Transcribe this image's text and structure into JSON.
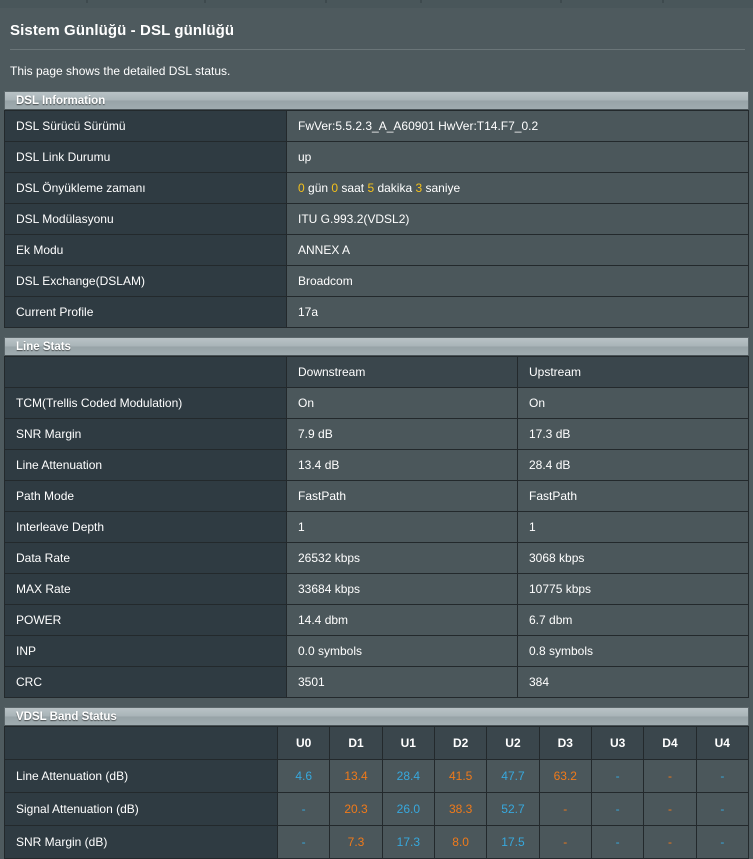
{
  "page": {
    "title": "Sistem Günlüğü - DSL günlüğü",
    "description": "This page shows the detailed DSL status."
  },
  "colors": {
    "upstream_accent": "#37a8dd",
    "downstream_accent": "#f07a1a",
    "highlight_number": "#f3c01b",
    "page_background": "#4e5a5e",
    "label_cell": "#2f3b42",
    "value_cell": "#4b575b"
  },
  "dsl_information": {
    "heading": "DSL Information",
    "rows": [
      {
        "label": "DSL Sürücü Sürümü",
        "value": "FwVer:5.5.2.3_A_A60901 HwVer:T14.F7_0.2"
      },
      {
        "label": "DSL Link Durumu",
        "value": "up"
      },
      {
        "label": "DSL Önyükleme zamanı",
        "value": "0 gün 0 saat 5 dakika 3 saniye",
        "parts": [
          {
            "text": "0",
            "style": "gold"
          },
          {
            "text": " gün ",
            "style": "plain"
          },
          {
            "text": "0",
            "style": "gold"
          },
          {
            "text": " saat ",
            "style": "plain"
          },
          {
            "text": "5",
            "style": "gold"
          },
          {
            "text": " dakika ",
            "style": "plain"
          },
          {
            "text": "3",
            "style": "gold"
          },
          {
            "text": " saniye",
            "style": "plain"
          }
        ]
      },
      {
        "label": "DSL Modülasyonu",
        "value": "ITU G.993.2(VDSL2)"
      },
      {
        "label": "Ek Modu",
        "value": "ANNEX A"
      },
      {
        "label": "DSL Exchange(DSLAM)",
        "value": "Broadcom"
      },
      {
        "label": "Current Profile",
        "value": "17a"
      }
    ]
  },
  "line_stats": {
    "heading": "Line Stats",
    "columns": [
      "",
      "Downstream",
      "Upstream"
    ],
    "rows": [
      {
        "label": "TCM(Trellis Coded Modulation)",
        "downstream": "On",
        "upstream": "On"
      },
      {
        "label": "SNR Margin",
        "downstream": "7.9 dB",
        "upstream": "17.3 dB"
      },
      {
        "label": "Line Attenuation",
        "downstream": "13.4 dB",
        "upstream": "28.4 dB"
      },
      {
        "label": "Path Mode",
        "downstream": "FastPath",
        "upstream": "FastPath"
      },
      {
        "label": "Interleave Depth",
        "downstream": "1",
        "upstream": "1"
      },
      {
        "label": "Data Rate",
        "downstream": "26532 kbps",
        "upstream": "3068 kbps"
      },
      {
        "label": "MAX Rate",
        "downstream": "33684 kbps",
        "upstream": "10775 kbps"
      },
      {
        "label": "POWER",
        "downstream": "14.4 dbm",
        "upstream": "6.7 dbm"
      },
      {
        "label": "INP",
        "downstream": "0.0 symbols",
        "upstream": "0.8 symbols"
      },
      {
        "label": "CRC",
        "downstream": "3501",
        "upstream": "384"
      }
    ]
  },
  "vdsl_band_status": {
    "heading": "VDSL Band Status",
    "bands": [
      "U0",
      "D1",
      "U1",
      "D2",
      "U2",
      "D3",
      "U3",
      "D4",
      "U4"
    ],
    "rows": [
      {
        "label": "Line Attenuation (dB)",
        "values": [
          "4.6",
          "13.4",
          "28.4",
          "41.5",
          "47.7",
          "63.2",
          "-",
          "-",
          "-"
        ]
      },
      {
        "label": "Signal Attenuation (dB)",
        "values": [
          "-",
          "20.3",
          "26.0",
          "38.3",
          "52.7",
          "-",
          "-",
          "-",
          "-"
        ]
      },
      {
        "label": "SNR Margin (dB)",
        "values": [
          "-",
          "7.3",
          "17.3",
          "8.0",
          "17.5",
          "-",
          "-",
          "-",
          "-"
        ]
      }
    ]
  }
}
